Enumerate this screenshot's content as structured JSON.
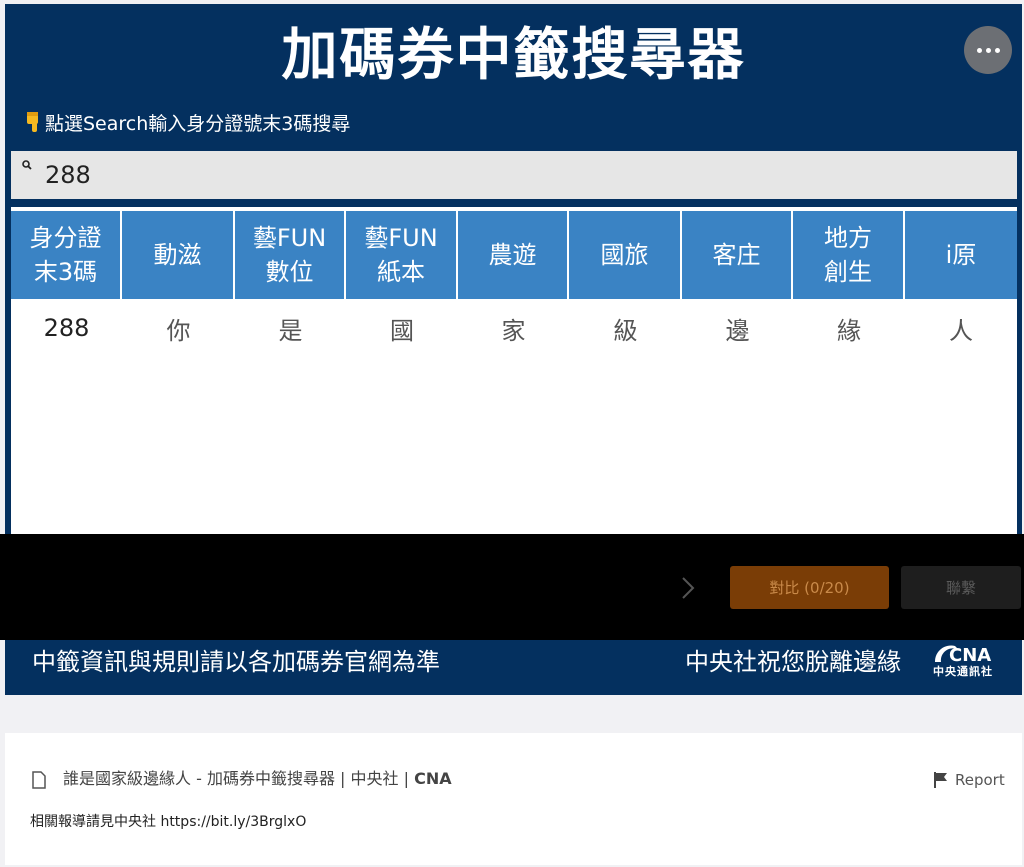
{
  "app": {
    "title": "加碼券中籤搜尋器",
    "instruction": "點選Search輸入身分證號末3碼搜尋"
  },
  "search": {
    "value": "288",
    "placeholder": "Search"
  },
  "table": {
    "columns": [
      "身分證\n末3碼",
      "動滋",
      "藝FUN\n數位",
      "藝FUN\n紙本",
      "農遊",
      "國旅",
      "客庄",
      "地方\n創生",
      "i原"
    ],
    "rows": [
      [
        "288",
        "你",
        "是",
        "國",
        "家",
        "級",
        "邊",
        "緣",
        "人"
      ]
    ]
  },
  "controls": {
    "compare_label": "對比 (0/20)",
    "contact_label": "聯繫"
  },
  "footer": {
    "left_text": "中籤資訊與規則請以各加碼券官網為準",
    "right_text": "中央社祝您脫離邊緣",
    "logo_text": "CNA",
    "logo_sub": "中央通訊社"
  },
  "info": {
    "title_prefix": "誰是國家級邊緣人 - 加碼券中籤搜尋器 | 中央社 | ",
    "title_brand": "CNA",
    "report_label": "Report",
    "related_text": "相關報導請見中央社 https://bit.ly/3BrglxO"
  },
  "colors": {
    "header_bg": "#04305f",
    "table_header": "#3a83c4",
    "compare_button": "#7a3d06"
  }
}
